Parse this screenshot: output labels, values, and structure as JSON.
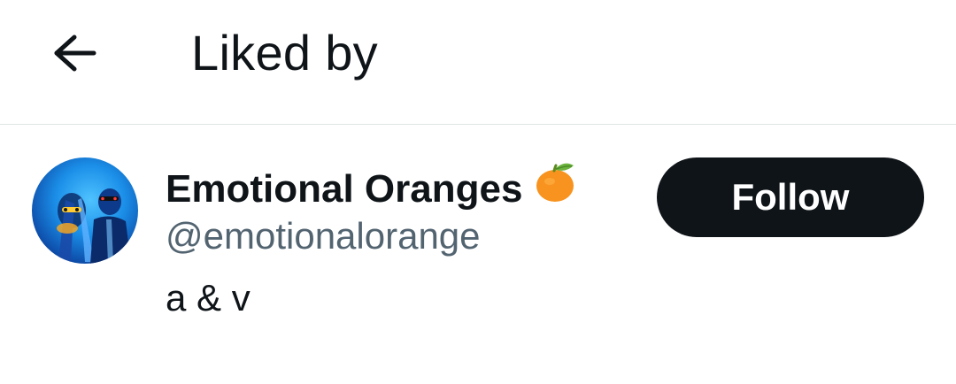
{
  "header": {
    "title": "Liked by",
    "back_icon": "arrow-left-icon"
  },
  "user": {
    "display_name": "Emotional Oranges",
    "name_emoji_icon": "tangerine-icon",
    "handle": "@emotionalorange",
    "bio": "a & v",
    "follow_label": "Follow"
  },
  "colors": {
    "text_primary": "#0f1419",
    "text_secondary": "#536471",
    "follow_button_bg": "#0f1419",
    "divider": "#e1e4e6"
  }
}
